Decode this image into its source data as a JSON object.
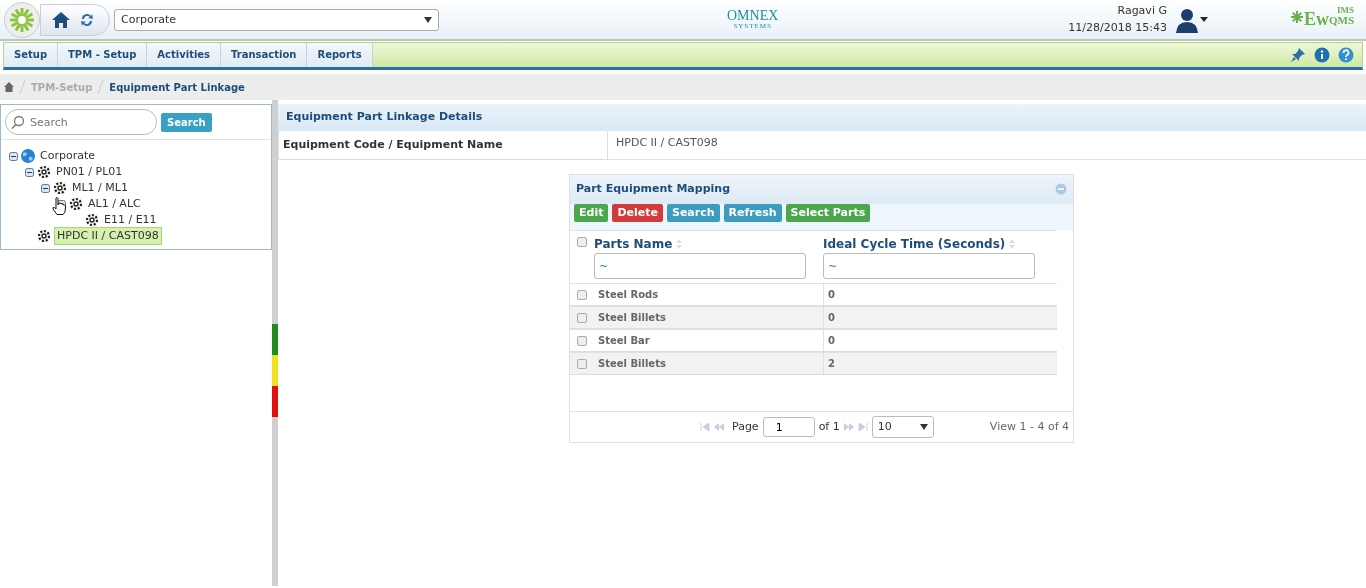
{
  "header": {
    "site_select": "Corporate",
    "logo_main": "OMNEX",
    "logo_sub": "SYSTEMS",
    "user_name": "Ragavi G",
    "datetime": "11/28/2018 15:43",
    "brand_left": "Ew",
    "brand_main": "QMS",
    "brand_sup": "IMS"
  },
  "menu": [
    {
      "label": "Setup"
    },
    {
      "label": "TPM - Setup"
    },
    {
      "label": "Activities"
    },
    {
      "label": "Transaction"
    },
    {
      "label": "Reports"
    }
  ],
  "breadcrumb": [
    {
      "label": "TPM-Setup",
      "current": false
    },
    {
      "label": "Equipment Part Linkage",
      "current": true
    }
  ],
  "tree_search": {
    "placeholder": "Search",
    "button": "Search"
  },
  "tree": [
    {
      "label": "Corporate",
      "kind": "site",
      "expanded": true,
      "selected": false,
      "children": [
        {
          "label": "PN01 / PL01",
          "kind": "equipment",
          "expanded": true,
          "selected": false,
          "children": [
            {
              "label": "ML1 / ML1",
              "kind": "equipment",
              "expanded": true,
              "selected": false,
              "children": [
                {
                  "label": "AL1 / ALC",
                  "kind": "equipment",
                  "expanded": true,
                  "selected": false,
                  "children": [
                    {
                      "label": "E11 / E11",
                      "kind": "equipment",
                      "selected": false
                    }
                  ]
                }
              ]
            }
          ]
        },
        {
          "label": "HPDC II / CAST098",
          "kind": "equipment",
          "selected": true
        }
      ]
    }
  ],
  "details": {
    "title": "Equipment Part Linkage Details",
    "field_label": "Equipment Code / Equipment Name",
    "field_value": "HPDC II / CAST098"
  },
  "grid": {
    "title": "Part Equipment Mapping",
    "select_all_checked": false,
    "buttons": [
      {
        "label": "Edit",
        "kind": "success"
      },
      {
        "label": "Delete",
        "kind": "danger"
      },
      {
        "label": "Search",
        "kind": "info"
      },
      {
        "label": "Refresh",
        "kind": "info"
      },
      {
        "label": "Select Parts",
        "kind": "success"
      }
    ],
    "columns": [
      {
        "label": "Parts Name",
        "filter": "~"
      },
      {
        "label": "Ideal Cycle Time (Seconds)",
        "filter": "~"
      }
    ],
    "rows": [
      {
        "cells": [
          "Steel Rods",
          "0"
        ],
        "checked": false
      },
      {
        "cells": [
          "Steel Billets",
          "0"
        ],
        "checked": false
      },
      {
        "cells": [
          "Steel Bar",
          "0"
        ],
        "checked": false
      },
      {
        "cells": [
          "Steel Billets",
          "2"
        ],
        "checked": false
      }
    ],
    "pager": {
      "page_label": "Page",
      "page": "1",
      "of": "of 1",
      "page_size": "10",
      "summary": "View 1 - 4 of 4"
    }
  }
}
